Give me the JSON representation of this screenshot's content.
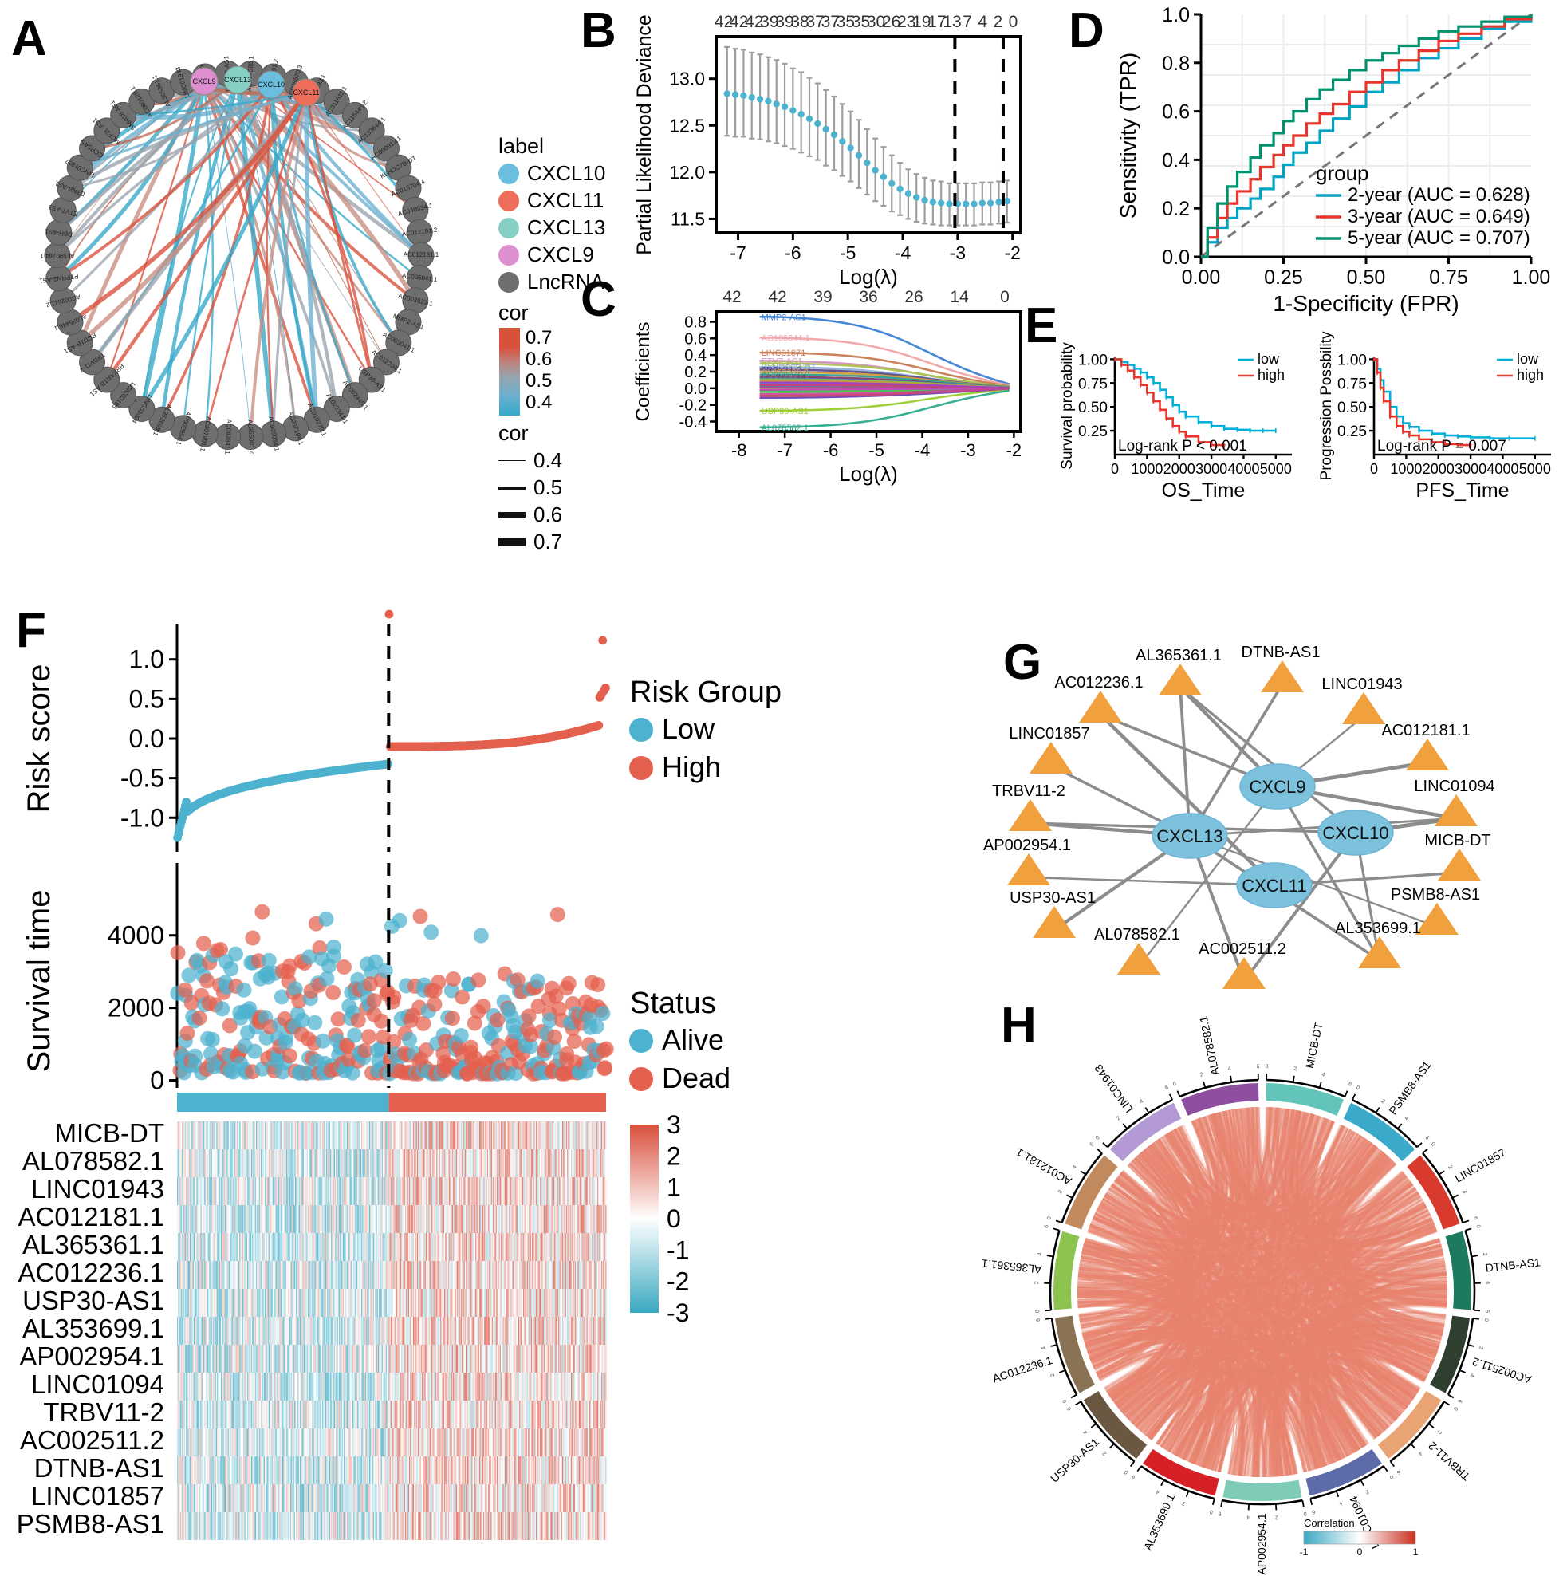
{
  "panels": {
    "A": "A",
    "B": "B",
    "C": "C",
    "D": "D",
    "E": "E",
    "F": "F",
    "G": "G",
    "H": "H"
  },
  "panelA": {
    "legend_label_title": "label",
    "legend_labels": [
      {
        "name": "CXCL10",
        "color": "#6bbede"
      },
      {
        "name": "CXCL11",
        "color": "#ee6e5b"
      },
      {
        "name": "CXCL13",
        "color": "#86cfc4"
      },
      {
        "name": "CXCL9",
        "color": "#dd8fd0"
      },
      {
        "name": "LncRNA",
        "color": "#6e6e6e"
      }
    ],
    "cor_title": "cor",
    "cor_scale": [
      "0.7",
      "0.6",
      "0.5",
      "0.4"
    ],
    "cor_width_title": "cor",
    "cor_widths": [
      "0.4",
      "0.5",
      "0.6",
      "0.7"
    ],
    "hubs": [
      "CXCL9",
      "CXCL13",
      "CXCL10",
      "CXCL11"
    ],
    "nodes": [
      "AC004585.1",
      "AC007991.2",
      "AC008870.3",
      "AC009093.1",
      "AC011611.1",
      "AC115446.2",
      "AC133644.1",
      "AC090912.1",
      "KLHDC7B-DT",
      "AC015704.4",
      "AC040934.1",
      "AC012191.2",
      "AC012181.1",
      "AC005041.1",
      "AC003923.1",
      "MMP2-AS1",
      "AC003041.1",
      "AC012204.1",
      "USP30-AS1",
      "AC002945.1",
      "AL022344.1",
      "AC010279.1",
      "AC037198.1",
      "AC005034.1",
      "AL355001.2",
      "AC083841.1",
      "AC007991.1",
      "AP002954.1",
      "AL353699.1",
      "LINC01094",
      "LINC02195",
      "PRKAR1B-AS1",
      "TRBV11-2",
      "PCD1B-AS1",
      "AL035446.1",
      "AC002511.2",
      "PTPRN2-AS1",
      "AL590764.1",
      "DBH-AS1",
      "ETV7-AS1",
      "DTNB-AS1",
      "LINC01857",
      "CCR5AS",
      "MCF2L-AS1",
      "SNHG8-AS1",
      "AC080128.1",
      "AL365361.1",
      "LINC01943",
      "MICB-DT",
      "PSMB8-AS1"
    ]
  },
  "chart_data": [
    {
      "type": "line",
      "panel": "B",
      "title": "",
      "xlabel": "Log(λ)",
      "ylabel": "Partial Likelihood Deviance",
      "xlim": [
        -7.4,
        -1.85
      ],
      "ylim": [
        11.35,
        13.45
      ],
      "xticks": [
        "-7",
        "-6",
        "-5",
        "-4",
        "-3",
        "-2"
      ],
      "yticks": [
        "11.5",
        "12.0",
        "12.5",
        "13.0"
      ],
      "top_axis_labels": [
        "42",
        "42",
        "42",
        "39",
        "39",
        "38",
        "37",
        "37",
        "35",
        "35",
        "30",
        "26",
        "23",
        "19",
        "17",
        "13",
        "7",
        "4",
        "2",
        "0"
      ],
      "point_color": "#4cb2cf",
      "errbar_color": "#9e9e9e",
      "vlines": [
        -3.05,
        -2.17
      ],
      "x": [
        -7.2,
        -7.05,
        -6.9,
        -6.75,
        -6.6,
        -6.45,
        -6.3,
        -6.15,
        -6.0,
        -5.85,
        -5.7,
        -5.55,
        -5.4,
        -5.25,
        -5.1,
        -4.95,
        -4.8,
        -4.65,
        -4.5,
        -4.35,
        -4.2,
        -4.05,
        -3.9,
        -3.75,
        -3.6,
        -3.45,
        -3.3,
        -3.15,
        -3.0,
        -2.85,
        -2.7,
        -2.55,
        -2.4,
        -2.25,
        -2.1
      ],
      "y": [
        12.84,
        12.83,
        12.82,
        12.8,
        12.78,
        12.76,
        12.73,
        12.7,
        12.66,
        12.62,
        12.57,
        12.52,
        12.46,
        12.4,
        12.33,
        12.26,
        12.18,
        12.1,
        12.02,
        11.95,
        11.88,
        11.82,
        11.77,
        11.73,
        11.7,
        11.68,
        11.67,
        11.66,
        11.66,
        11.66,
        11.66,
        11.67,
        11.67,
        11.68,
        11.69
      ],
      "yerr_up": [
        0.5,
        0.49,
        0.49,
        0.48,
        0.48,
        0.47,
        0.47,
        0.46,
        0.45,
        0.45,
        0.44,
        0.43,
        0.42,
        0.41,
        0.4,
        0.39,
        0.38,
        0.36,
        0.34,
        0.32,
        0.3,
        0.28,
        0.26,
        0.25,
        0.24,
        0.23,
        0.23,
        0.22,
        0.22,
        0.22,
        0.22,
        0.22,
        0.22,
        0.22,
        0.22
      ],
      "yerr_dn": [
        0.45,
        0.45,
        0.44,
        0.44,
        0.43,
        0.43,
        0.42,
        0.42,
        0.41,
        0.41,
        0.4,
        0.39,
        0.39,
        0.38,
        0.37,
        0.36,
        0.35,
        0.34,
        0.33,
        0.31,
        0.3,
        0.28,
        0.27,
        0.26,
        0.25,
        0.24,
        0.24,
        0.23,
        0.23,
        0.23,
        0.23,
        0.23,
        0.23,
        0.23,
        0.23
      ]
    },
    {
      "type": "line",
      "panel": "C",
      "title": "",
      "xlabel": "Log(λ)",
      "ylabel": "Coefficients",
      "xlim": [
        -8.5,
        -1.85
      ],
      "ylim": [
        -0.52,
        0.92
      ],
      "xticks": [
        "-8",
        "-7",
        "-6",
        "-5",
        "-4",
        "-3",
        "-2"
      ],
      "yticks": [
        "-0.4",
        "-0.2",
        "0.0",
        "0.2",
        "0.4",
        "0.6",
        "0.8"
      ],
      "top_axis_labels": [
        "42",
        "42",
        "39",
        "36",
        "26",
        "14",
        "0"
      ],
      "curve_labels": [
        {
          "name": "MMP2-AS1",
          "y": 0.86,
          "color": "#3b7fd4"
        },
        {
          "name": "AC133644.1",
          "y": 0.61,
          "color": "#f0a4aa"
        },
        {
          "name": "LINC01871",
          "y": 0.43,
          "color": "#c87c52"
        },
        {
          "name": "ETV7-AS1",
          "y": 0.33,
          "color": "#d68fc4"
        },
        {
          "name": "AC003041.1",
          "y": 0.3,
          "color": "#a8c44a"
        },
        {
          "name": "KLHDC7B-DT",
          "y": 0.255,
          "color": "#8fb3dd"
        },
        {
          "name": "TRBV11-2",
          "y": 0.225,
          "color": "#5f4b8b"
        },
        {
          "name": "AL355001.2",
          "y": 0.195,
          "color": "#cf9c38"
        },
        {
          "name": "AC008870.3",
          "y": 0.165,
          "color": "#2f9e8f"
        },
        {
          "name": "LINC01094",
          "y": 0.135,
          "color": "#8b3a62"
        },
        {
          "name": "AC012204.1",
          "y": 0.105,
          "color": "#7aa35c"
        },
        {
          "name": "AP002954.1",
          "y": 0.075,
          "color": "#c24b6b"
        },
        {
          "name": "AL365361.1",
          "y": 0.045,
          "color": "#4d9bd6"
        },
        {
          "name": "AC002511.2",
          "y": 0.015,
          "color": "#8c6db5"
        },
        {
          "name": "AC012181.1",
          "y": -0.02,
          "color": "#d4b24a"
        },
        {
          "name": "USP30-AS1",
          "y": -0.27,
          "color": "#9acd32"
        },
        {
          "name": "AL078582.1",
          "y": -0.47,
          "color": "#2eab8b"
        }
      ]
    },
    {
      "type": "line",
      "panel": "D",
      "title": "",
      "xlabel": "1-Specificity (FPR)",
      "ylabel": "Sensitivity (TPR)",
      "xlim": [
        0,
        1
      ],
      "ylim": [
        0,
        1
      ],
      "xticks": [
        "0.00",
        "0.25",
        "0.50",
        "0.75",
        "1.00"
      ],
      "yticks": [
        "0.0",
        "0.2",
        "0.4",
        "0.6",
        "0.8",
        "1.0"
      ],
      "legend_title": "group",
      "series": [
        {
          "name": "2-year (AUC = 0.628)",
          "color": "#00a3c4",
          "x": [
            0,
            0.02,
            0.05,
            0.08,
            0.11,
            0.15,
            0.18,
            0.22,
            0.25,
            0.28,
            0.32,
            0.36,
            0.4,
            0.45,
            0.5,
            0.55,
            0.6,
            0.66,
            0.72,
            0.78,
            0.85,
            0.92,
            1.0
          ],
          "y": [
            0,
            0.06,
            0.12,
            0.16,
            0.2,
            0.24,
            0.28,
            0.33,
            0.38,
            0.43,
            0.47,
            0.52,
            0.57,
            0.62,
            0.68,
            0.72,
            0.77,
            0.82,
            0.86,
            0.9,
            0.94,
            0.97,
            1.0
          ]
        },
        {
          "name": "3-year (AUC = 0.649)",
          "color": "#e8342b",
          "x": [
            0,
            0.02,
            0.05,
            0.08,
            0.11,
            0.15,
            0.18,
            0.22,
            0.25,
            0.28,
            0.32,
            0.36,
            0.4,
            0.45,
            0.5,
            0.55,
            0.6,
            0.66,
            0.72,
            0.78,
            0.85,
            0.92,
            1.0
          ],
          "y": [
            0,
            0.08,
            0.16,
            0.22,
            0.27,
            0.32,
            0.37,
            0.42,
            0.46,
            0.5,
            0.55,
            0.59,
            0.63,
            0.68,
            0.72,
            0.77,
            0.81,
            0.85,
            0.89,
            0.92,
            0.95,
            0.98,
            1.0
          ]
        },
        {
          "name": "5-year (AUC = 0.707)",
          "color": "#00916e",
          "x": [
            0,
            0.02,
            0.05,
            0.08,
            0.11,
            0.15,
            0.18,
            0.22,
            0.25,
            0.28,
            0.32,
            0.36,
            0.4,
            0.45,
            0.5,
            0.55,
            0.6,
            0.66,
            0.72,
            0.78,
            0.85,
            0.92,
            1.0
          ],
          "y": [
            0,
            0.12,
            0.22,
            0.29,
            0.35,
            0.41,
            0.46,
            0.51,
            0.56,
            0.6,
            0.65,
            0.69,
            0.73,
            0.77,
            0.81,
            0.84,
            0.87,
            0.9,
            0.93,
            0.95,
            0.97,
            0.99,
            1.0
          ]
        }
      ],
      "diagonal": true
    },
    {
      "type": "line",
      "panel": "E-left",
      "title": "",
      "xlabel": "OS_Time",
      "ylabel": "Survival probability",
      "xlim": [
        0,
        5500
      ],
      "ylim": [
        0,
        1.02
      ],
      "xticks": [
        "0",
        "1000",
        "2000",
        "3000",
        "4000",
        "5000"
      ],
      "yticks": [
        "0.25",
        "0.50",
        "0.75",
        "1.00"
      ],
      "annotation": "Log-rank P < 0.001",
      "legend": [
        {
          "name": "low",
          "color": "#00b0d8"
        },
        {
          "name": "high",
          "color": "#e8342b"
        }
      ],
      "series": [
        {
          "name": "low",
          "color": "#00b0d8",
          "x": [
            0,
            200,
            400,
            600,
            800,
            1000,
            1200,
            1400,
            1600,
            1800,
            2000,
            2200,
            2600,
            3000,
            3400,
            3800,
            4200,
            4600,
            5000
          ],
          "y": [
            1.0,
            0.97,
            0.94,
            0.9,
            0.86,
            0.81,
            0.75,
            0.68,
            0.6,
            0.52,
            0.45,
            0.4,
            0.34,
            0.3,
            0.27,
            0.26,
            0.25,
            0.25,
            0.25
          ]
        },
        {
          "name": "high",
          "color": "#e8342b",
          "x": [
            0,
            200,
            400,
            600,
            800,
            1000,
            1200,
            1400,
            1600,
            1800,
            2000,
            2200,
            2600,
            3000,
            3400
          ],
          "y": [
            1.0,
            0.94,
            0.88,
            0.81,
            0.73,
            0.65,
            0.56,
            0.47,
            0.38,
            0.3,
            0.24,
            0.19,
            0.13,
            0.1,
            0.09
          ]
        }
      ]
    },
    {
      "type": "line",
      "panel": "E-right",
      "title": "",
      "xlabel": "PFS_Time",
      "ylabel": "Progression Possbility",
      "xlim": [
        0,
        5500
      ],
      "ylim": [
        0,
        1.02
      ],
      "xticks": [
        "0",
        "1000",
        "2000",
        "3000",
        "4000",
        "5000"
      ],
      "yticks": [
        "0.25",
        "0.50",
        "0.75",
        "1.00"
      ],
      "annotation": "Log-rank P = 0.007",
      "legend": [
        {
          "name": "low",
          "color": "#00b0d8"
        },
        {
          "name": "high",
          "color": "#e8342b"
        }
      ],
      "series": [
        {
          "name": "low",
          "color": "#00b0d8",
          "x": [
            0,
            100,
            200,
            300,
            500,
            700,
            900,
            1100,
            1400,
            1800,
            2200,
            2600,
            3000,
            3600,
            4200,
            5000
          ],
          "y": [
            1.0,
            0.9,
            0.78,
            0.66,
            0.5,
            0.4,
            0.33,
            0.29,
            0.25,
            0.22,
            0.2,
            0.19,
            0.18,
            0.17,
            0.17,
            0.17
          ]
        },
        {
          "name": "high",
          "color": "#e8342b",
          "x": [
            0,
            100,
            200,
            300,
            500,
            700,
            900,
            1100,
            1400,
            1800,
            2200,
            2600,
            3000
          ],
          "y": [
            1.0,
            0.86,
            0.7,
            0.56,
            0.4,
            0.3,
            0.24,
            0.2,
            0.16,
            0.13,
            0.11,
            0.1,
            0.09
          ]
        }
      ]
    },
    {
      "type": "scatter",
      "panel": "F-risk",
      "ylabel": "Risk score",
      "ylim": [
        -1.35,
        1.35
      ],
      "yticks": [
        "-1.0",
        "-0.5",
        "0.0",
        "0.5",
        "1.0"
      ],
      "legend_title": "Risk Group",
      "legend": [
        {
          "name": "Low",
          "color": "#4cb2cf"
        },
        {
          "name": "High",
          "color": "#e4604e"
        }
      ],
      "cutpoint_fraction": 0.495
    },
    {
      "type": "scatter",
      "panel": "F-survival",
      "ylabel": "Survival time",
      "ylim": [
        -120,
        5600
      ],
      "yticks": [
        "0",
        "2000",
        "4000"
      ],
      "legend_title": "Status",
      "legend": [
        {
          "name": "Alive",
          "color": "#4cb2cf"
        },
        {
          "name": "Dead",
          "color": "#e4604e"
        }
      ]
    },
    {
      "type": "heatmap",
      "panel": "F-heatmap",
      "rows": [
        "MICB-DT",
        "AL078582.1",
        "LINC01943",
        "AC012181.1",
        "AL365361.1",
        "AC012236.1",
        "USP30-AS1",
        "AL353699.1",
        "AP002954.1",
        "LINC01094",
        "TRBV11-2",
        "AC002511.2",
        "DTNB-AS1",
        "LINC01857",
        "PSMB8-AS1"
      ],
      "colorbar_ticks": [
        "3",
        "2",
        "1",
        "0",
        "-1",
        "-2",
        "-3"
      ],
      "colorbar_range": [
        -3,
        3
      ],
      "low_color": "#3aa8c1",
      "mid_color": "#ffffff",
      "high_color": "#d94f3d"
    },
    {
      "type": "diagram",
      "panel": "G",
      "hub_nodes": [
        "CXCL9",
        "CXCL10",
        "CXCL11",
        "CXCL13"
      ],
      "hub_color": "#7dc2dd",
      "lnc_color": "#f0a03c",
      "lnc_nodes": [
        "AL365361.1",
        "DTNB-AS1",
        "AC012236.1",
        "LINC01943",
        "LINC01857",
        "AC012181.1",
        "TRBV11-2",
        "LINC01094",
        "AP002954.1",
        "MICB-DT",
        "USP30-AS1",
        "PSMB8-AS1",
        "AL078582.1",
        "AL353699.1",
        "AC002511.2"
      ]
    },
    {
      "type": "heatmap",
      "panel": "H",
      "title": "",
      "sectors": [
        {
          "name": "MICB-DT",
          "color": "#63c4b9"
        },
        {
          "name": "PSMB8-AS1",
          "color": "#3ba9c9"
        },
        {
          "name": "LINC01857",
          "color": "#d93a2e"
        },
        {
          "name": "DTNB-AS1",
          "color": "#1d7a5e"
        },
        {
          "name": "AC002511.2",
          "color": "#2f3f2f"
        },
        {
          "name": "TRBV11-2",
          "color": "#e8a573"
        },
        {
          "name": "LINC01094",
          "color": "#5d6ba8"
        },
        {
          "name": "AP002954.1",
          "color": "#7ecbb8"
        },
        {
          "name": "AL353699.1",
          "color": "#d61f26"
        },
        {
          "name": "USP30-AS1",
          "color": "#6b5843"
        },
        {
          "name": "AC012236.1",
          "color": "#8a7355"
        },
        {
          "name": "AL365361.1",
          "color": "#8cc44f"
        },
        {
          "name": "AC012181.1",
          "color": "#c18a5e"
        },
        {
          "name": "LINC01943",
          "color": "#b49ad4"
        },
        {
          "name": "AL078582.1",
          "color": "#8e4fa0"
        }
      ],
      "legend_title": "Correlation",
      "legend_ticks": [
        "-1",
        "0",
        "1"
      ],
      "legend_low": "#3aa8c1",
      "legend_mid": "#ffffff",
      "legend_high": "#c9301f"
    }
  ]
}
